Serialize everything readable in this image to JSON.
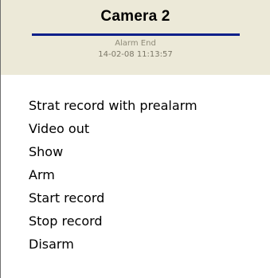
{
  "header": {
    "title": "Camera 2",
    "event": "Alarm End",
    "timestamp": "14-02-08 11:13:57"
  },
  "menu": {
    "items": [
      {
        "label": "Strat record with prealarm"
      },
      {
        "label": "Video out"
      },
      {
        "label": "Show"
      },
      {
        "label": "Arm"
      },
      {
        "label": "Start record"
      },
      {
        "label": "Stop record"
      },
      {
        "label": "Disarm"
      }
    ]
  },
  "colors": {
    "header_bg": "#ece9d8",
    "title_rule": "#0b1f8a",
    "status_text": "#8e8a78"
  }
}
